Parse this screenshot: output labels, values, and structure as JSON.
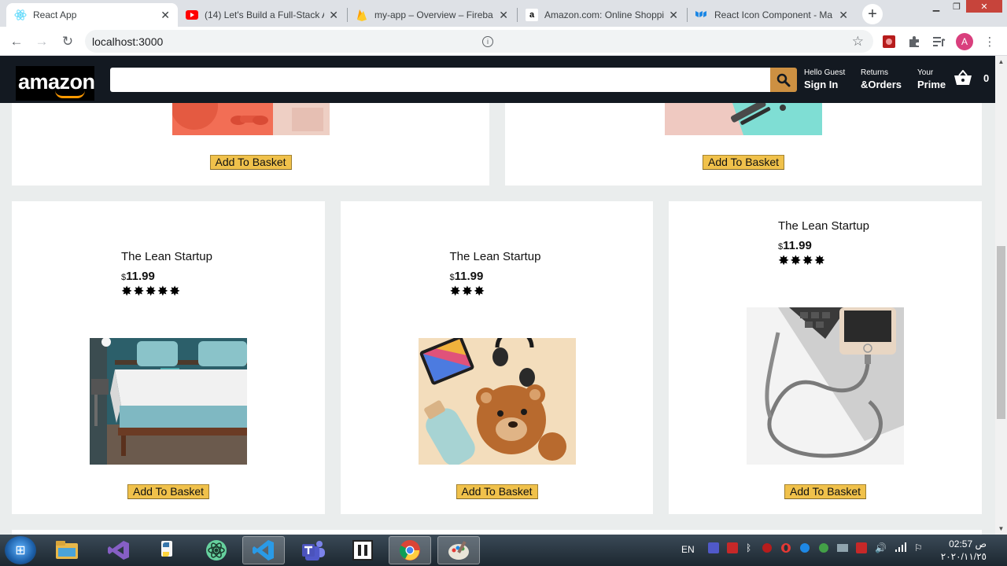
{
  "browser": {
    "tabs": [
      {
        "title": "React App",
        "active": true,
        "favicon": "react-favicon"
      },
      {
        "title": "(14) Let's Build a Full-Stack A",
        "active": false,
        "favicon": "youtube-favicon"
      },
      {
        "title": "my-app – Overview – Fireba",
        "active": false,
        "favicon": "firebase-favicon"
      },
      {
        "title": "Amazon.com: Online Shoppi",
        "active": false,
        "favicon": "amazon-favicon"
      },
      {
        "title": "React Icon Component - Ma",
        "active": false,
        "favicon": "material-ui-favicon"
      }
    ],
    "url": "localhost:3000",
    "profile_initial": "A"
  },
  "header": {
    "logo": "amazon",
    "search_value": "",
    "options": [
      {
        "line1": "Hello Guest",
        "line2": "Sign In"
      },
      {
        "line1": "Returns",
        "line2": "&Orders"
      },
      {
        "line1": "Your",
        "line2": "Prime"
      }
    ],
    "basket_count": "0"
  },
  "top_row": [
    {
      "button": "Add To Basket",
      "image": "dumbbells-orange"
    },
    {
      "button": "Add To Basket",
      "image": "pink-makeup-pouch"
    }
  ],
  "products": [
    {
      "title": "The Lean Startup",
      "currency": "$",
      "price": "11.99",
      "rating": 5,
      "image": "bed-bedroom",
      "button": "Add To Basket"
    },
    {
      "title": "The Lean Startup",
      "currency": "$",
      "price": "11.99",
      "rating": 3,
      "image": "tablet-headphones-teddy-bear",
      "button": "Add To Basket"
    },
    {
      "title": "The Lean Startup",
      "currency": "$",
      "price": "11.99",
      "rating": 4,
      "image": "iphone-charging-cable",
      "button": "Add To Basket"
    }
  ],
  "taskbar": {
    "language": "EN",
    "time": "02:57 ص",
    "date": "٢٠٢٠/١١/٢٥"
  },
  "colors": {
    "header_bg": "#131921",
    "search_button": "#cd9042",
    "add_button": "#f0c14b",
    "page_bg": "#eaeded"
  }
}
